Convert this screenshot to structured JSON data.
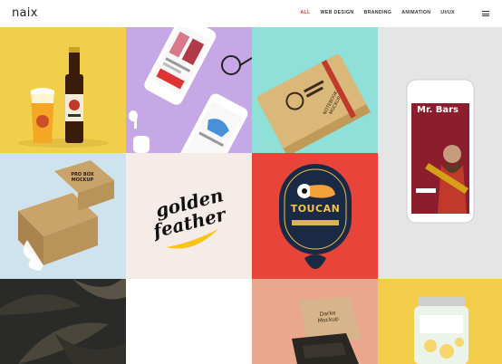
{
  "brand": {
    "logo": "naix"
  },
  "nav": {
    "items": [
      {
        "label": "ALL",
        "active": true
      },
      {
        "label": "WEB DESIGN",
        "active": false
      },
      {
        "label": "BRANDING",
        "active": false
      },
      {
        "label": "ANIMATION",
        "active": false
      },
      {
        "label": "UI/UX",
        "active": false
      }
    ],
    "menu_icon": "hamburger-icon"
  },
  "tiles": {
    "beer": {
      "bg": "#f2cf4b"
    },
    "phones": {
      "bg": "#c6a8e6"
    },
    "notebook": {
      "bg": "#8ee0d8",
      "cover_text": "NOTEBOOK MOCKUP"
    },
    "mrbars": {
      "bg": "#e5e5e5",
      "screen_title": "Mr. Bars"
    },
    "probox": {
      "bg": "#cfe3ef",
      "box_text": "PRO BOX MOCKUP"
    },
    "golden": {
      "bg": "#f5ece7",
      "logo_line1": "golden",
      "logo_line2": "feather"
    },
    "toucan": {
      "bg": "#e8443a",
      "badge_text": "TOUCAN"
    },
    "leaves": {
      "bg": "#2a2a28"
    },
    "darko": {
      "bg": "#e9a88e",
      "box_text": "Darko Mockup"
    },
    "jar": {
      "bg": "#f3cd4a"
    }
  }
}
